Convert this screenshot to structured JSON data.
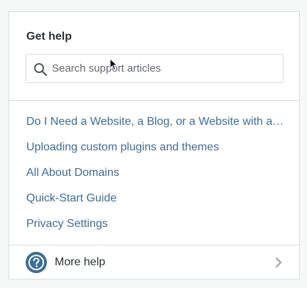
{
  "panel": {
    "title": "Get help"
  },
  "search": {
    "placeholder": "Search support articles",
    "icon": "search-icon"
  },
  "links": [
    {
      "label": "Do I Need a Website, a Blog, or a Website with a Blog?"
    },
    {
      "label": "Uploading custom plugins and themes"
    },
    {
      "label": "All About Domains"
    },
    {
      "label": "Quick-Start Guide"
    },
    {
      "label": "Privacy Settings"
    }
  ],
  "footer": {
    "label": "More help",
    "icon": "help-circle-icon",
    "chevron": "chevron-right-icon"
  },
  "colors": {
    "link": "#3d6d95",
    "text": "#2c3338",
    "border": "#dcdcde",
    "help_icon": "#3d6d95"
  }
}
